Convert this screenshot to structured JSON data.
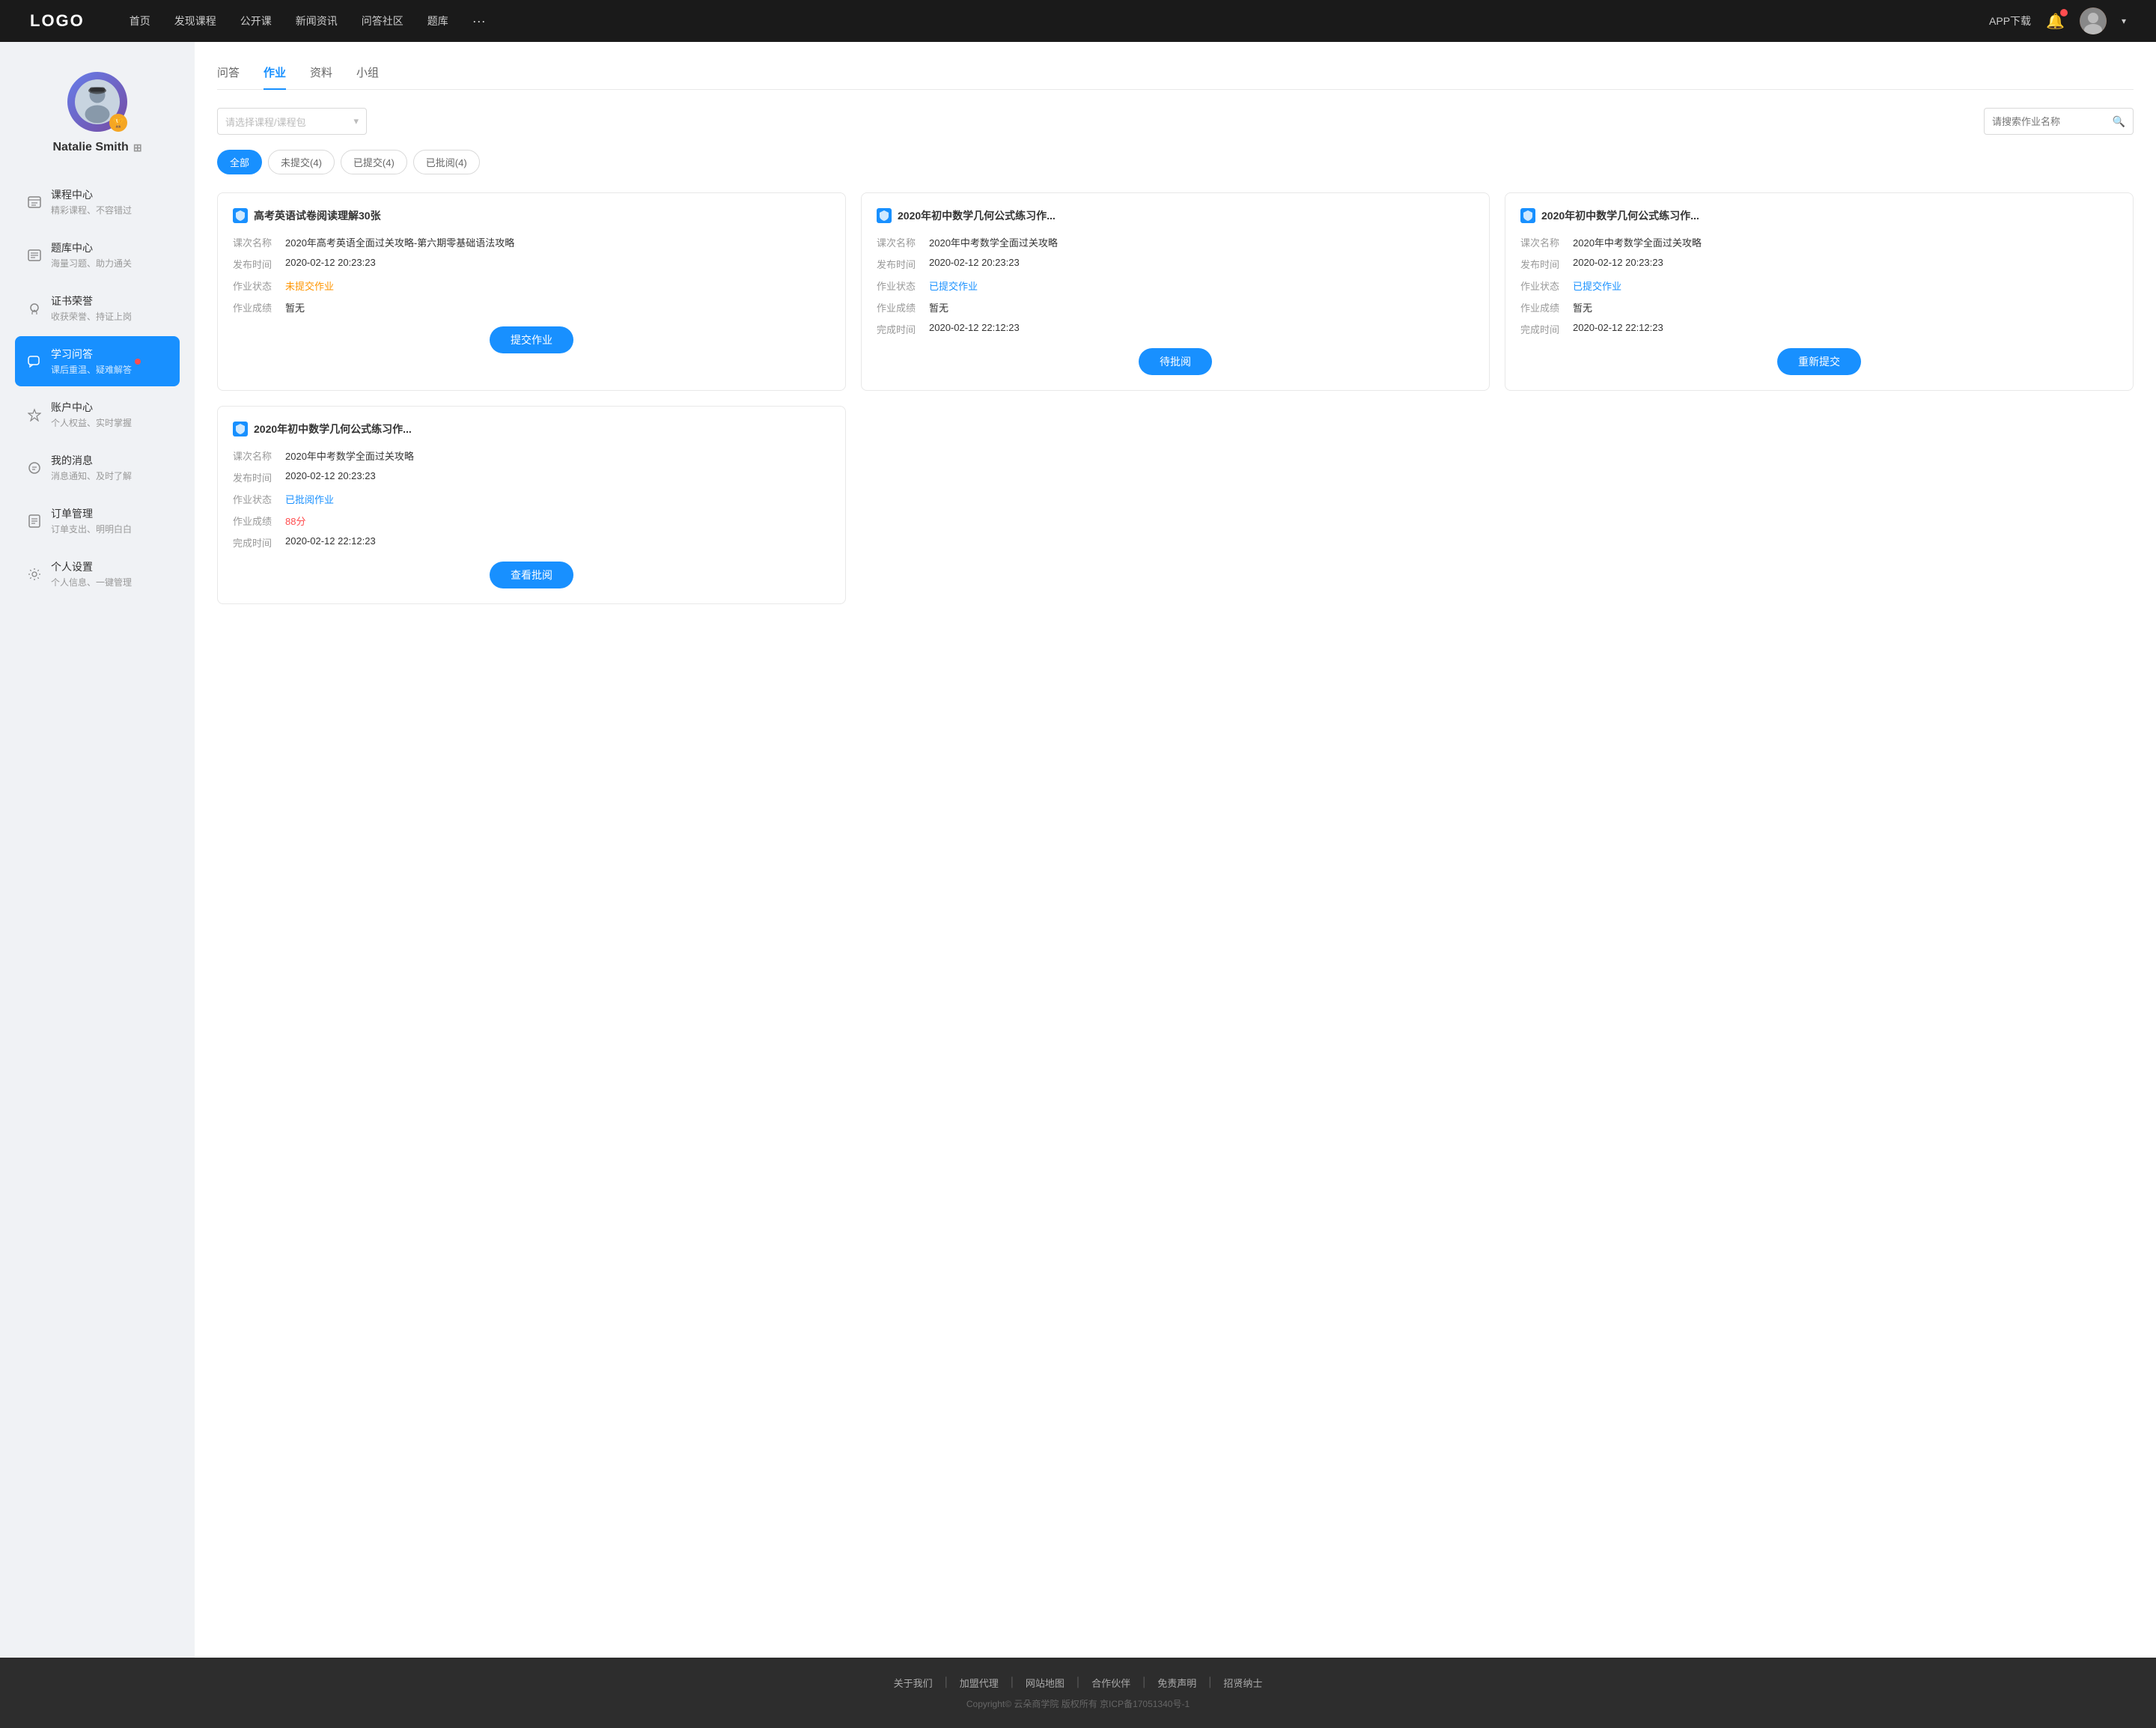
{
  "nav": {
    "logo": "LOGO",
    "links": [
      "首页",
      "发现课程",
      "公开课",
      "新闻资讯",
      "问答社区",
      "题库"
    ],
    "more": "···",
    "download": "APP下载"
  },
  "sidebar": {
    "profile": {
      "name": "Natalie Smith",
      "icon_label": "⊞"
    },
    "items": [
      {
        "id": "course-center",
        "icon": "📋",
        "title": "课程中心",
        "subtitle": "精彩课程、不容错过",
        "active": false,
        "badge": false
      },
      {
        "id": "question-bank",
        "icon": "≡",
        "title": "题库中心",
        "subtitle": "海量习题、助力通关",
        "active": false,
        "badge": false
      },
      {
        "id": "certificate",
        "icon": "⚙",
        "title": "证书荣誉",
        "subtitle": "收获荣誉、持证上岗",
        "active": false,
        "badge": false
      },
      {
        "id": "study-qa",
        "icon": "💬",
        "title": "学习问答",
        "subtitle": "课后重温、疑难解答",
        "active": true,
        "badge": true
      },
      {
        "id": "account-center",
        "icon": "◇",
        "title": "账户中心",
        "subtitle": "个人权益、实时掌握",
        "active": false,
        "badge": false
      },
      {
        "id": "messages",
        "icon": "💭",
        "title": "我的消息",
        "subtitle": "消息通知、及时了解",
        "active": false,
        "badge": false
      },
      {
        "id": "orders",
        "icon": "📄",
        "title": "订单管理",
        "subtitle": "订单支出、明明白白",
        "active": false,
        "badge": false
      },
      {
        "id": "settings",
        "icon": "⚙",
        "title": "个人设置",
        "subtitle": "个人信息、一键管理",
        "active": false,
        "badge": false
      }
    ]
  },
  "content": {
    "tabs": [
      "问答",
      "作业",
      "资料",
      "小组"
    ],
    "active_tab": "作业",
    "filter": {
      "course_placeholder": "请选择课程/课程包",
      "search_placeholder": "请搜索作业名称"
    },
    "status_tabs": [
      {
        "label": "全部",
        "active": true
      },
      {
        "label": "未提交(4)",
        "active": false
      },
      {
        "label": "已提交(4)",
        "active": false
      },
      {
        "label": "已批阅(4)",
        "active": false
      }
    ],
    "cards": [
      {
        "title": "高考英语试卷阅读理解30张",
        "course_name": "2020年高考英语全面过关攻略-第六期零基础语法攻略",
        "publish_time": "2020-02-12 20:23:23",
        "status_label": "未提交作业",
        "status_type": "unsubmitted",
        "score": "暂无",
        "complete_time": "",
        "button_label": "提交作业",
        "show_complete_time": false
      },
      {
        "title": "2020年初中数学几何公式练习作...",
        "course_name": "2020年中考数学全面过关攻略",
        "publish_time": "2020-02-12 20:23:23",
        "status_label": "已提交作业",
        "status_type": "submitted",
        "score": "暂无",
        "complete_time": "2020-02-12 22:12:23",
        "button_label": "待批阅",
        "show_complete_time": true
      },
      {
        "title": "2020年初中数学几何公式练习作...",
        "course_name": "2020年中考数学全面过关攻略",
        "publish_time": "2020-02-12 20:23:23",
        "status_label": "已提交作业",
        "status_type": "submitted",
        "score": "暂无",
        "complete_time": "2020-02-12 22:12:23",
        "button_label": "重新提交",
        "show_complete_time": true
      },
      {
        "title": "2020年初中数学几何公式练习作...",
        "course_name": "2020年中考数学全面过关攻略",
        "publish_time": "2020-02-12 20:23:23",
        "status_label": "已批阅作业",
        "status_type": "reviewed",
        "score": "88分",
        "score_type": "red",
        "complete_time": "2020-02-12 22:12:23",
        "button_label": "查看批阅",
        "show_complete_time": true
      }
    ],
    "card_labels": {
      "course": "课次名称",
      "publish": "发布时间",
      "status": "作业状态",
      "score": "作业成绩",
      "complete": "完成时间"
    }
  },
  "footer": {
    "links": [
      "关于我们",
      "加盟代理",
      "网站地图",
      "合作伙伴",
      "免责声明",
      "招贤纳士"
    ],
    "copyright": "Copyright© 云朵商学院  版权所有    京ICP备17051340号-1"
  }
}
